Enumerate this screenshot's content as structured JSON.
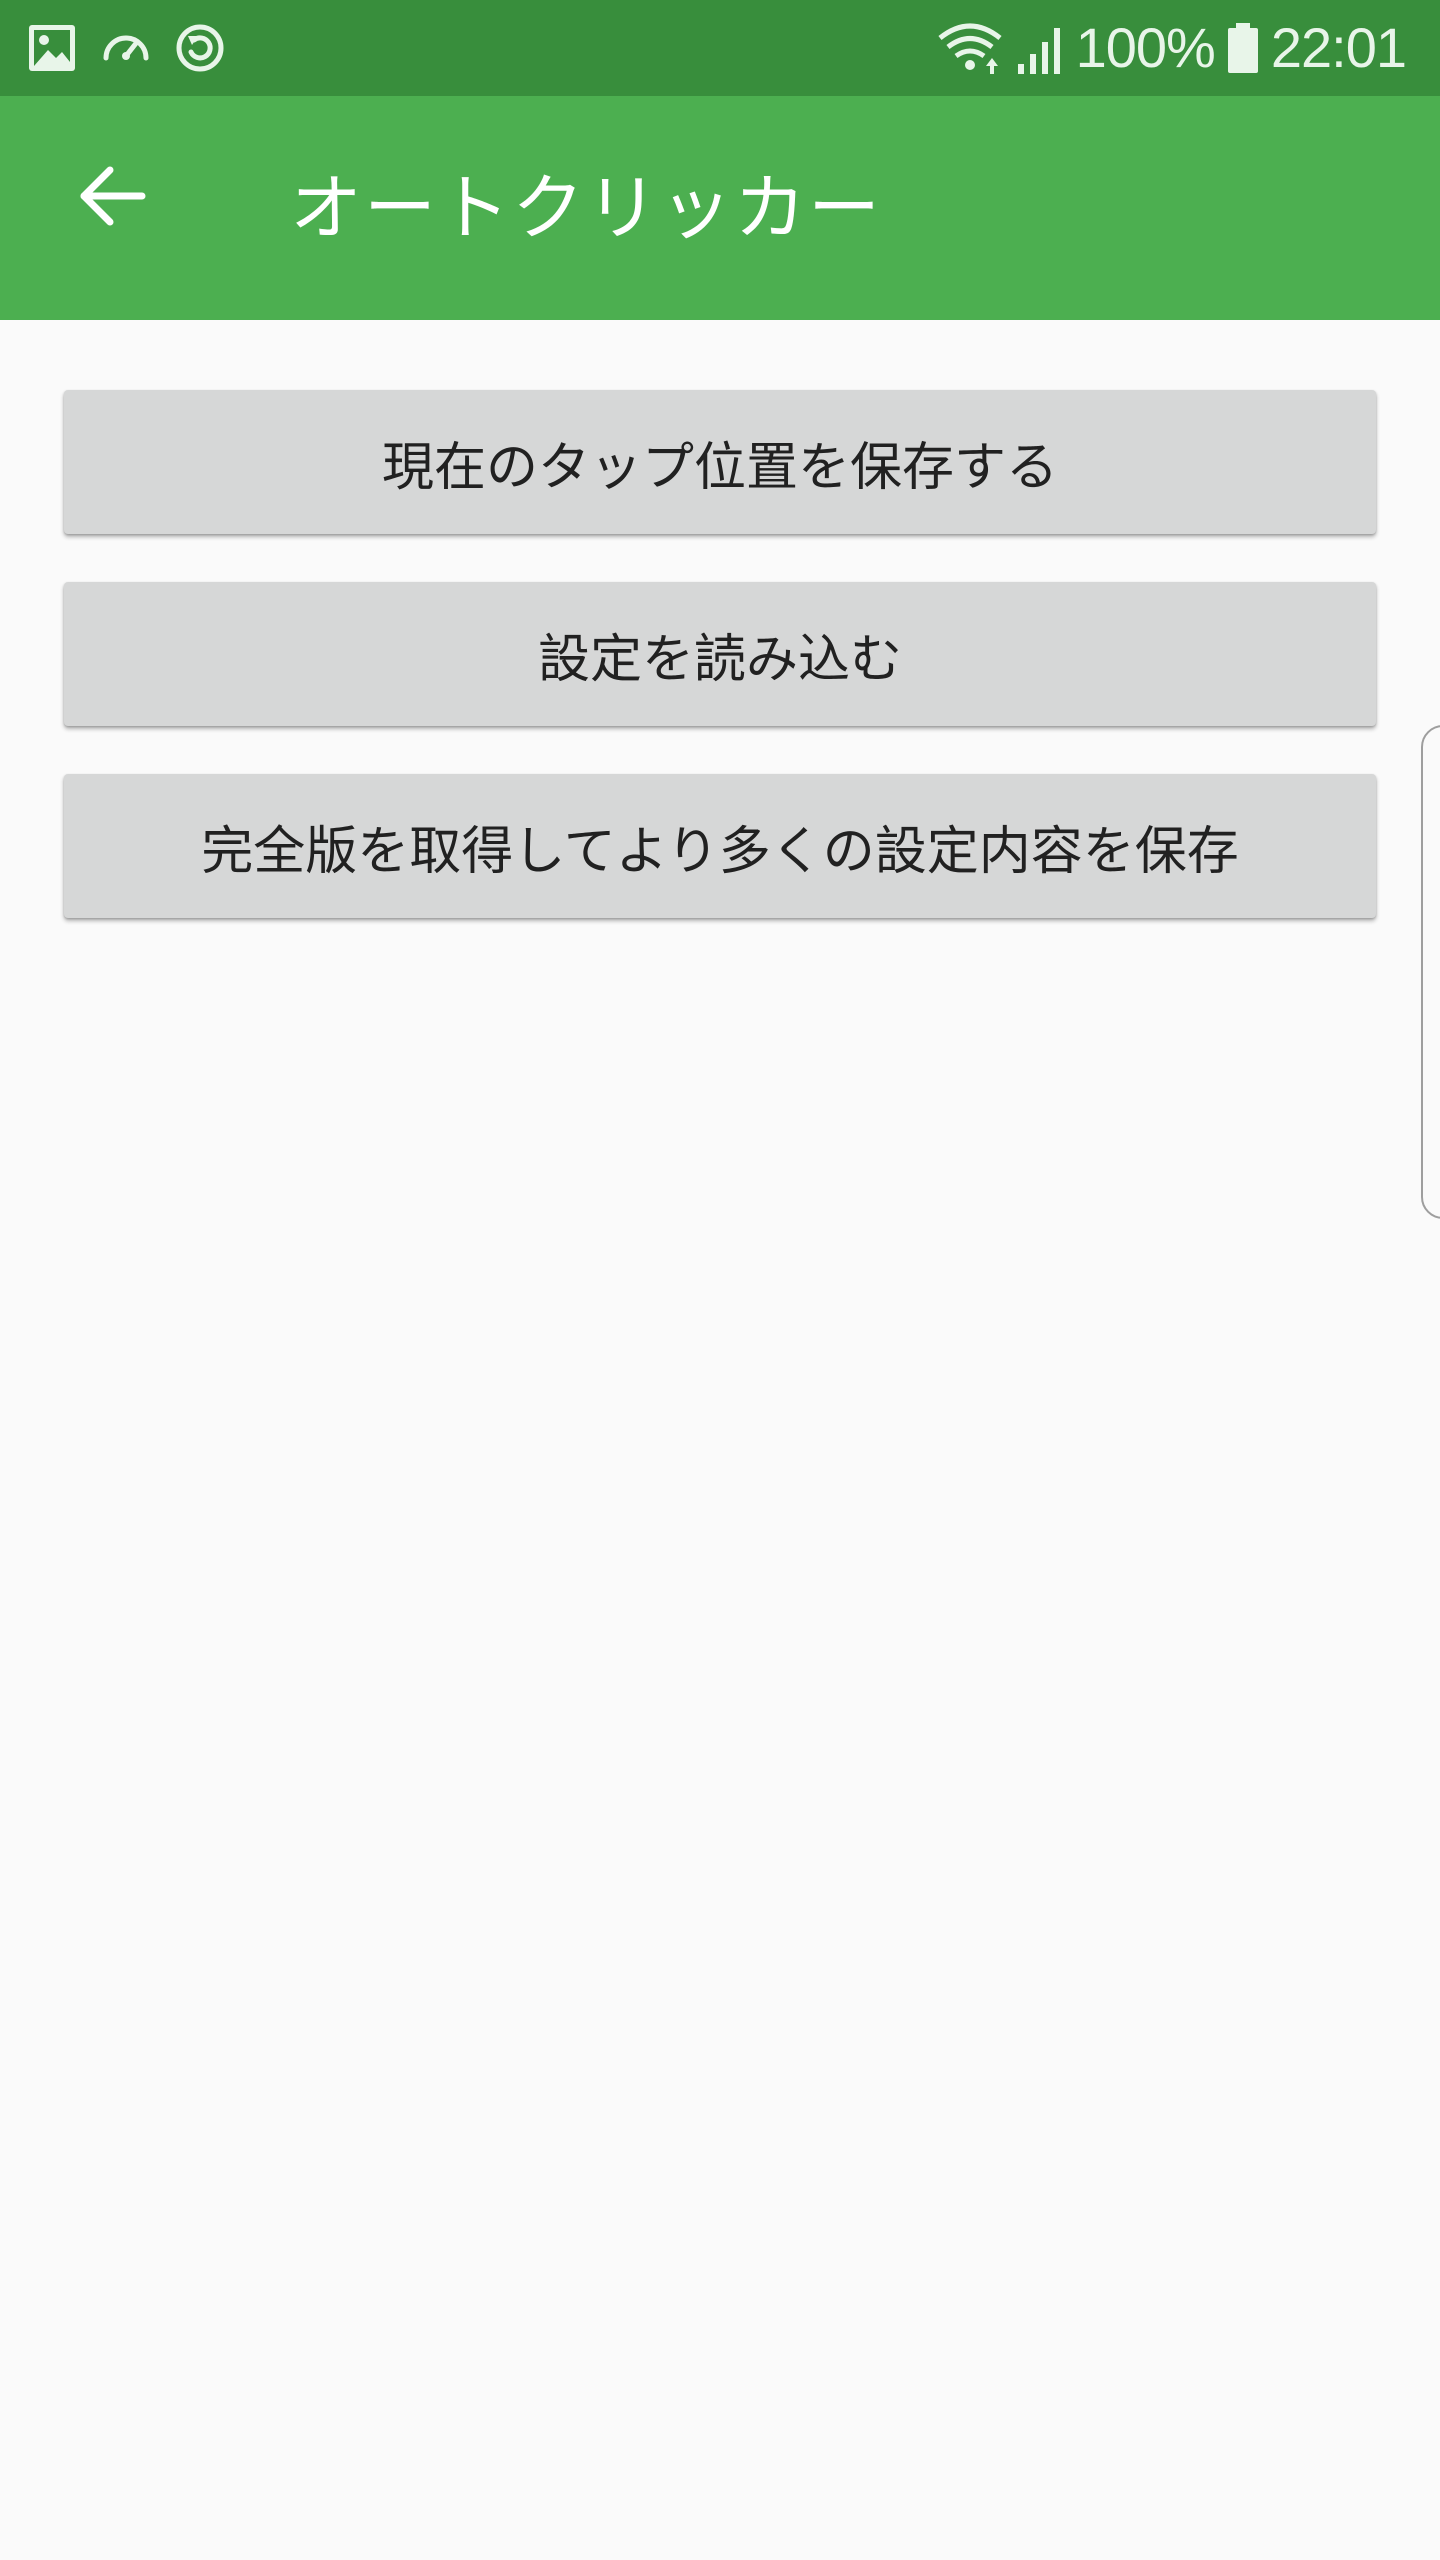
{
  "status_bar": {
    "left_icons": [
      "image-icon",
      "speedometer-icon",
      "sync-circle-icon"
    ],
    "right_icons": [
      "wifi-icon",
      "signal-icon",
      "battery-icon"
    ],
    "battery": "100%",
    "time": "22:01",
    "color": "#388e3c"
  },
  "app_bar": {
    "back_icon": "arrow-left-icon",
    "title": "オートクリッカー",
    "color": "#4caf50"
  },
  "main": {
    "buttons": [
      {
        "label": "現在のタップ位置を保存する"
      },
      {
        "label": "設定を読み込む"
      },
      {
        "label": "完全版を取得してより多くの設定内容を保存"
      }
    ]
  }
}
